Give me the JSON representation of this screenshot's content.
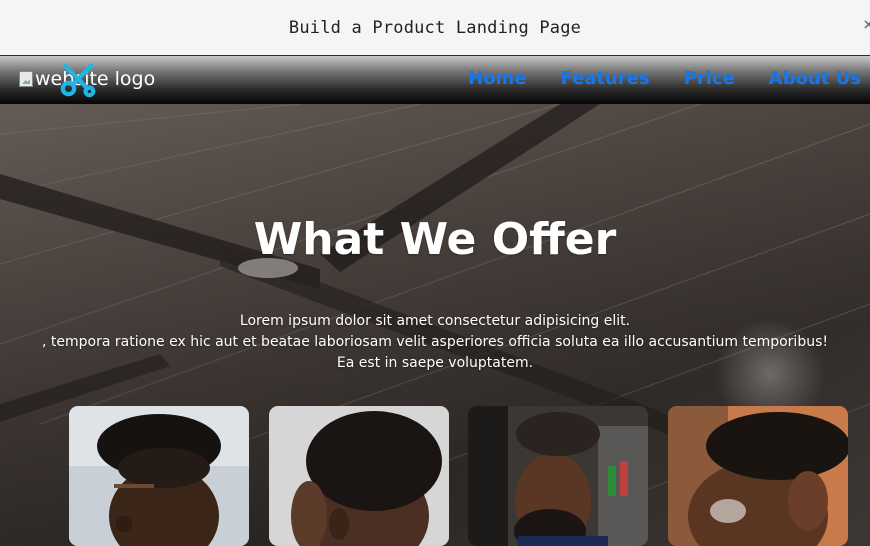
{
  "task": {
    "title": "Build a Product Landing Page",
    "close_glyph": "×"
  },
  "navbar": {
    "logo_alt": "website logo",
    "logo_icon": "scissors-icon",
    "links": [
      "Home",
      "Features",
      "Price",
      "About Us"
    ],
    "link_color": "#1877e8"
  },
  "hero": {
    "title": "What We Offer",
    "lines": [
      "Lorem ipsum dolor sit amet consectetur adipisicing elit.",
      ", tempora ratione ex hic aut et beatae laboriosam velit asperiores officia soluta ea illo accusantium temporibus!",
      "Ea est in saepe voluptatem."
    ]
  },
  "cards": [
    {
      "name": "haircut-photo-1"
    },
    {
      "name": "haircut-photo-2"
    },
    {
      "name": "haircut-photo-3"
    },
    {
      "name": "haircut-photo-4"
    }
  ]
}
